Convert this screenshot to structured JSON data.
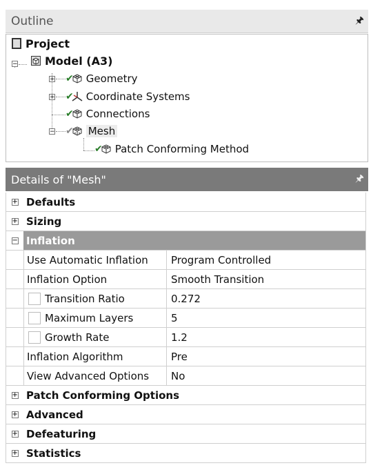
{
  "outline": {
    "title": "Outline",
    "pin": "ⅈ",
    "tree": {
      "project": "Project",
      "model": "Model (A3)",
      "geometry": "Geometry",
      "coordinate_systems": "Coordinate Systems",
      "connections": "Connections",
      "mesh": "Mesh",
      "patch_conforming_method": "Patch Conforming Method"
    }
  },
  "details": {
    "title": "Details of \"Mesh\"",
    "pin": "ⅈ",
    "sections": {
      "defaults": "Defaults",
      "sizing": "Sizing",
      "inflation": "Inflation",
      "patch_conforming_options": "Patch Conforming Options",
      "advanced": "Advanced",
      "defeaturing": "Defeaturing",
      "statistics": "Statistics"
    },
    "rows": [
      {
        "name": "Use Automatic Inflation",
        "value": "Program Controlled"
      },
      {
        "name": "Inflation Option",
        "value": "Smooth Transition"
      },
      {
        "name": "Transition Ratio",
        "value": "0.272"
      },
      {
        "name": "Maximum Layers",
        "value": "5"
      },
      {
        "name": "Growth Rate",
        "value": "1.2"
      },
      {
        "name": "Inflation Algorithm",
        "value": "Pre"
      },
      {
        "name": "View Advanced Options",
        "value": "No"
      }
    ]
  },
  "symbols": {
    "expand": "+",
    "collapse": "−"
  }
}
